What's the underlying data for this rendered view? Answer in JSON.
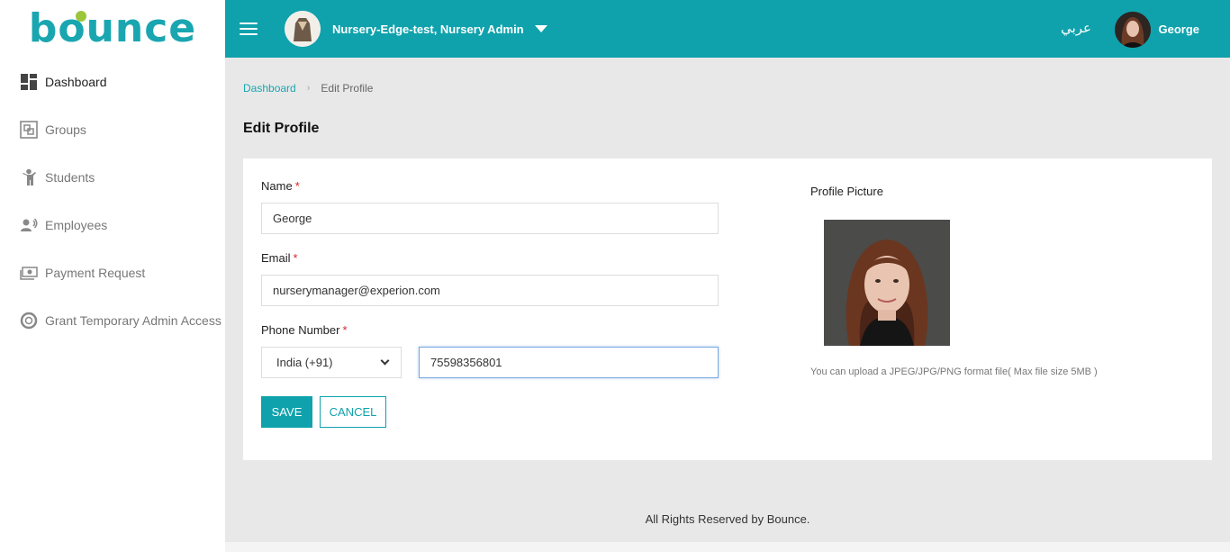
{
  "brand": {
    "logo_text": "bounce",
    "accent": "#0fa2ac",
    "logo_dot": "#9cc63a"
  },
  "sidebar": {
    "items": [
      {
        "label": "Dashboard",
        "icon": "dashboard-icon",
        "active": true
      },
      {
        "label": "Groups",
        "icon": "groups-icon"
      },
      {
        "label": "Students",
        "icon": "student-icon"
      },
      {
        "label": "Employees",
        "icon": "employee-icon"
      },
      {
        "label": "Payment Request",
        "icon": "money-icon"
      },
      {
        "label": "Grant Temporary Admin Access",
        "icon": "lifebuoy-icon"
      }
    ]
  },
  "header": {
    "nursery_label": "Nursery-Edge-test, Nursery Admin",
    "language_label": "عربي",
    "user_name": "George"
  },
  "breadcrumb": {
    "home": "Dashboard",
    "current": "Edit Profile"
  },
  "page": {
    "title": "Edit Profile"
  },
  "form": {
    "name_label": "Name",
    "name_value": "George",
    "email_label": "Email",
    "email_value": "nurserymanager@experion.com",
    "phone_label": "Phone Number",
    "country_code": "India (+91)",
    "phone_value": "75598356801",
    "required_mark": "*",
    "save_label": "SAVE",
    "cancel_label": "CANCEL"
  },
  "profile_picture": {
    "label": "Profile Picture",
    "hint": "You can upload a JPEG/JPG/PNG format file( Max file size 5MB )"
  },
  "footer": {
    "text": "All Rights Reserved by Bounce."
  }
}
